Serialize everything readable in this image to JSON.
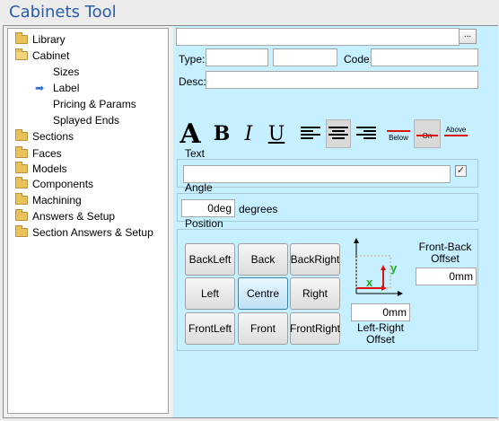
{
  "window": {
    "title": "Cabinets Tool"
  },
  "tree": {
    "items": [
      {
        "label": "Library",
        "icon": "folder-icon"
      },
      {
        "label": "Cabinet",
        "icon": "folder-open-icon"
      },
      {
        "label": "Sizes"
      },
      {
        "label": "Label",
        "icon": "arrow-right-icon",
        "selected": true
      },
      {
        "label": "Pricing & Params"
      },
      {
        "label": "Splayed Ends"
      },
      {
        "label": "Sections",
        "icon": "folder-icon"
      },
      {
        "label": "Faces",
        "icon": "folder-icon"
      },
      {
        "label": "Models",
        "icon": "folder-icon"
      },
      {
        "label": "Components",
        "icon": "folder-icon"
      },
      {
        "label": "Machining",
        "icon": "folder-icon"
      },
      {
        "label": "Answers & Setup",
        "icon": "folder-icon"
      },
      {
        "label": "Section Answers & Setup",
        "icon": "folder-icon"
      }
    ]
  },
  "form": {
    "path_value": "",
    "browse_label": "...",
    "type_label": "Type:",
    "type_value": "",
    "type2_value": "",
    "code_label": "Code:",
    "code_value": "",
    "desc_label": "Desc:",
    "desc_value": ""
  },
  "format": {
    "font_glyph": "A",
    "bold": "B",
    "italic": "I",
    "underline": "U",
    "below": "Below",
    "on": "On",
    "above": "Above"
  },
  "text_group": {
    "title": "Text",
    "value": "",
    "checked": true,
    "check_glyph": "✓"
  },
  "angle_group": {
    "title": "Angle",
    "value": "0deg",
    "unit": "degrees"
  },
  "position_group": {
    "title": "Position",
    "buttons": [
      "BackLeft",
      "Back",
      "BackRight",
      "Left",
      "Centre",
      "Right",
      "FrontLeft",
      "Front",
      "FrontRight"
    ],
    "selected": "Centre",
    "diagram_x": "x",
    "diagram_y": "y",
    "left_right_value": "0mm",
    "left_right_label_1": "Left-Right",
    "left_right_label_2": "Offset",
    "front_back_label_1": "Front-Back",
    "front_back_label_2": "Offset",
    "front_back_value": "0mm"
  },
  "colors": {
    "panel_bg": "#c6efff",
    "accent_title": "#2a5caa",
    "selected_button": "#bfe2f7"
  }
}
